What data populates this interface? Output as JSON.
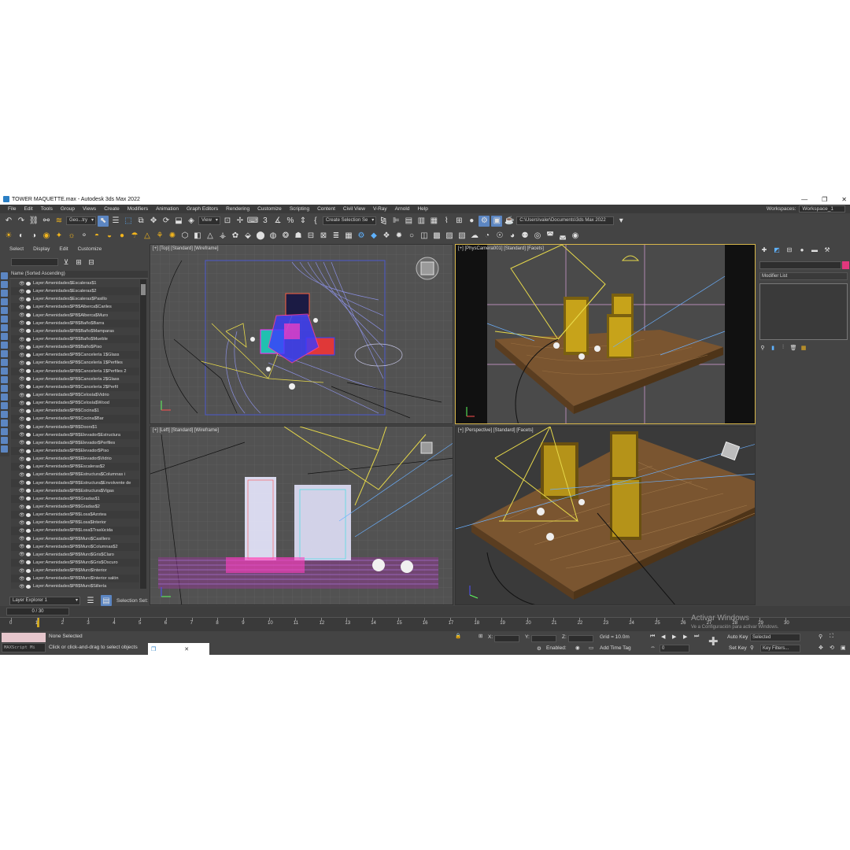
{
  "window": {
    "title": "TOWER MAQUETTE.max - Autodesk 3ds Max 2022",
    "minimize": "—",
    "maximize": "❐",
    "close": "✕"
  },
  "menu": [
    "File",
    "Edit",
    "Tools",
    "Group",
    "Views",
    "Create",
    "Modifiers",
    "Animation",
    "Graph Editors",
    "Rendering",
    "Customize",
    "Scripting",
    "Content",
    "Civil View",
    "V-Ray",
    "Arnold",
    "Help"
  ],
  "workspace": {
    "label": "Workspaces:",
    "value": "Workspace_1"
  },
  "toolbar": {
    "filter": "Geo...try",
    "refcoord": "View",
    "selection_set": "Create Selection Se",
    "project_path": "C:\\Users\\valer\\Documents\\3ds Max 2022"
  },
  "explorer": {
    "menu": [
      "Select",
      "Display",
      "Edit",
      "Customize"
    ],
    "header": "Name (Sorted Ascending)",
    "layers": [
      "Layer:Amenidades$Escaleras$1",
      "Layer:Amenidades$Escaleras$2",
      "Layer:Amenidades$Escaleras$Pasillo",
      "Layer:Amenidades$PB$Alberca$Cariles",
      "Layer:Amenidades$PB$Alberca$Muro",
      "Layer:Amenidades$PB$Baño$Barra",
      "Layer:Amenidades$PB$Baño$Mamparas",
      "Layer:Amenidades$PB$Baño$Mueble",
      "Layer:Amenidades$PB$Baño$Piso",
      "Layer:Amenidades$PB$Cancelería 1$Glass",
      "Layer:Amenidades$PB$Cancelería 1$Perfiles",
      "Layer:Amenidades$PB$Cancelería 1$Perfiles 2",
      "Layer:Amenidades$PB$Cancelería 2$Glass",
      "Layer:Amenidades$PB$Cancelería 2$Perfil",
      "Layer:Amenidades$PB$Celosía$Vidrio",
      "Layer:Amenidades$PB$Celosía$Wood",
      "Layer:Amenidades$PB$Cocina$1",
      "Layer:Amenidades$PB$Cocina$Bar",
      "Layer:Amenidades$PB$Doors$1",
      "Layer:Amenidades$PB$Elevador$Estructura",
      "Layer:Amenidades$PB$Elevador$Perfiles",
      "Layer:Amenidades$PB$Elevador$Piso",
      "Layer:Amenidades$PB$Elevador$Vidrio",
      "Layer:Amenidades$PB$Escaleras$2",
      "Layer:Amenidades$PB$Estructura$Columnas i",
      "Layer:Amenidades$PB$Estructura$Envolvente de",
      "Layer:Amenidades$PB$Estructura$Vigas",
      "Layer:Amenidades$PB$Gradas$1",
      "Layer:Amenidades$PB$Gradas$2",
      "Layer:Amenidades$PB$Losa$Azotea",
      "Layer:Amenidades$PB$Losa$Interior",
      "Layer:Amenidades$PB$Losa$Traslúcida",
      "Layer:Amenidades$PB$Muro$Casillero",
      "Layer:Amenidades$PB$Muro$Columnas$2",
      "Layer:Amenidades$PB$Muro$Gris$Claro",
      "Layer:Amenidades$PB$Muro$Gris$Oscuro",
      "Layer:Amenidades$PB$Muro$Interior",
      "Layer:Amenidades$PB$Muro$Interior salón",
      "Layer:Amenidades$PB$Muro$Sillería"
    ],
    "explorer_name": "Layer Explorer 1",
    "selection_set": "Selection Set:"
  },
  "viewports": {
    "top": "[+] [Top] [Standard] [Wireframe]",
    "camera": "[+] [PhysCamera001] [Standard] [Facets]",
    "left": "[+] [Left] [Standard] [Wireframe]",
    "perspective": "[+] [Perspective] [Standard] [Facets]"
  },
  "command_panel": {
    "modifier_list": "Modifier List"
  },
  "timeline": {
    "frame": "0 / 30",
    "ticks": [
      "0",
      "1",
      "2",
      "3",
      "4",
      "5",
      "6",
      "7",
      "8",
      "9",
      "10",
      "11",
      "12",
      "13",
      "14",
      "15",
      "16",
      "17",
      "18",
      "19",
      "20",
      "21",
      "22",
      "23",
      "24",
      "25",
      "26",
      "27",
      "28",
      "29",
      "30"
    ]
  },
  "status": {
    "selected": "None Selected",
    "hint": "Click or click-and-drag to select objects",
    "maxscript": "MAXScript Mi",
    "x": "X:",
    "y": "Y:",
    "z": "Z:",
    "grid": "Grid = 10.0m",
    "enabled": "Enabled:",
    "add_time_tag": "Add Time Tag",
    "auto_key": "Auto Key",
    "selected_mode": "Selected",
    "set_key": "Set Key",
    "key_filters": "Key Filters...",
    "frame_value": "0"
  },
  "watermark": {
    "line1": "Activar Windows",
    "line2": "Ve a Configuración para activar Windows."
  },
  "colors": {
    "ui_bg": "#444444",
    "accent": "#5c86c2",
    "highlight": "#f2b51d",
    "camera_border": "#d7b64a"
  }
}
